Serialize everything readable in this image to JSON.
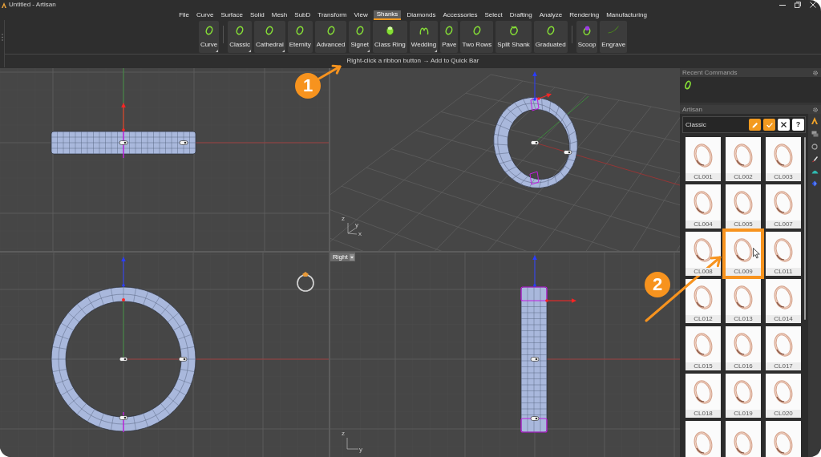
{
  "window": {
    "title": "Untitled - Artisan"
  },
  "menu_tabs": [
    {
      "label": "File",
      "selected": false
    },
    {
      "label": "Curve",
      "selected": false
    },
    {
      "label": "Surface",
      "selected": false
    },
    {
      "label": "Solid",
      "selected": false
    },
    {
      "label": "Mesh",
      "selected": false
    },
    {
      "label": "SubD",
      "selected": false
    },
    {
      "label": "Transform",
      "selected": false
    },
    {
      "label": "View",
      "selected": false
    },
    {
      "label": "Shanks",
      "selected": true
    },
    {
      "label": "Diamonds",
      "selected": false
    },
    {
      "label": "Accessories",
      "selected": false
    },
    {
      "label": "Select",
      "selected": false
    },
    {
      "label": "Drafting",
      "selected": false
    },
    {
      "label": "Analyze",
      "selected": false
    },
    {
      "label": "Rendering",
      "selected": false
    },
    {
      "label": "Manufacturing",
      "selected": false
    }
  ],
  "ribbon": {
    "groups": [
      {
        "buttons": [
          {
            "label": "Curve",
            "dropdown": true
          }
        ]
      },
      {
        "buttons": [
          {
            "label": "Classic",
            "dropdown": true
          },
          {
            "label": "Cathedral",
            "dropdown": true
          },
          {
            "label": "Eternity",
            "dropdown": false
          },
          {
            "label": "Advanced",
            "dropdown": false
          },
          {
            "label": "Signet",
            "dropdown": true
          },
          {
            "label": "Class Ring",
            "dropdown": false
          },
          {
            "label": "Wedding",
            "dropdown": true
          },
          {
            "label": "Pave",
            "dropdown": false
          },
          {
            "label": "Two Rows",
            "dropdown": false
          },
          {
            "label": "Split Shank",
            "dropdown": false
          },
          {
            "label": "Graduated",
            "dropdown": false
          }
        ]
      },
      {
        "buttons": [
          {
            "label": "Scoop",
            "dropdown": false
          },
          {
            "label": "Engrave",
            "dropdown": false
          }
        ]
      }
    ]
  },
  "hint_bar": {
    "text": "Right-click a ribbon button → Add to Quick Bar"
  },
  "viewports": [
    {
      "kind": "edge"
    },
    {
      "kind": "perspective",
      "axis_letters": [
        "z",
        "y",
        "x"
      ]
    },
    {
      "kind": "face"
    },
    {
      "kind": "side",
      "label": "Right",
      "axis_letters": [
        "z",
        "y"
      ]
    }
  ],
  "recent_commands": {
    "title": "Recent Commands"
  },
  "artisan_panel": {
    "title": "Artisan",
    "category": "Classic",
    "help_label": "?",
    "items": [
      {
        "label": "CL001",
        "highlighted": false
      },
      {
        "label": "CL002",
        "highlighted": false
      },
      {
        "label": "CL003",
        "highlighted": false
      },
      {
        "label": "CL004",
        "highlighted": false
      },
      {
        "label": "CL005",
        "highlighted": false
      },
      {
        "label": "CL007",
        "highlighted": false
      },
      {
        "label": "CL008",
        "highlighted": false
      },
      {
        "label": "CL009",
        "highlighted": true
      },
      {
        "label": "CL011",
        "highlighted": false
      },
      {
        "label": "CL012",
        "highlighted": false
      },
      {
        "label": "CL013",
        "highlighted": false
      },
      {
        "label": "CL014",
        "highlighted": false
      },
      {
        "label": "CL015",
        "highlighted": false
      },
      {
        "label": "CL016",
        "highlighted": false
      },
      {
        "label": "CL017",
        "highlighted": false
      },
      {
        "label": "CL018",
        "highlighted": false
      },
      {
        "label": "CL019",
        "highlighted": false
      },
      {
        "label": "CL020",
        "highlighted": false
      },
      {
        "highlighted": false
      },
      {
        "highlighted": false
      },
      {
        "highlighted": false
      }
    ]
  },
  "annotations": [
    {
      "number": "1"
    },
    {
      "number": "2"
    }
  ]
}
